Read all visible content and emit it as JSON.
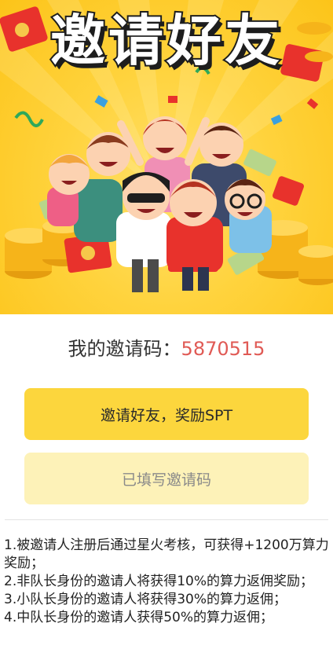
{
  "banner": {
    "title": "邀请好友",
    "colors": {
      "background": "#fcc419",
      "coin": "#f6b41a",
      "envelope": "#e8322c"
    },
    "icons": [
      "red-envelope-icon",
      "gold-coin-icon",
      "money-bill-icon",
      "confetti-icon"
    ]
  },
  "invite": {
    "label": "我的邀请码：",
    "code": "5870515",
    "code_color": "#e05a55"
  },
  "buttons": {
    "invite_friends": "邀请好友，奖励SPT",
    "invite_code_filled": "已填写邀请码",
    "primary_color": "#fcd63d",
    "secondary_color": "#fdf2b8"
  },
  "rules": [
    "1.被邀请人注册后通过星火考核，可获得+1200万算力奖励；",
    "2.非队长身份的邀请人将获得10%的算力返佣奖励；",
    "3.小队长身份的邀请人将获得30%的算力返佣；",
    "4.中队长身份的邀请人获得50%的算力返佣；"
  ]
}
